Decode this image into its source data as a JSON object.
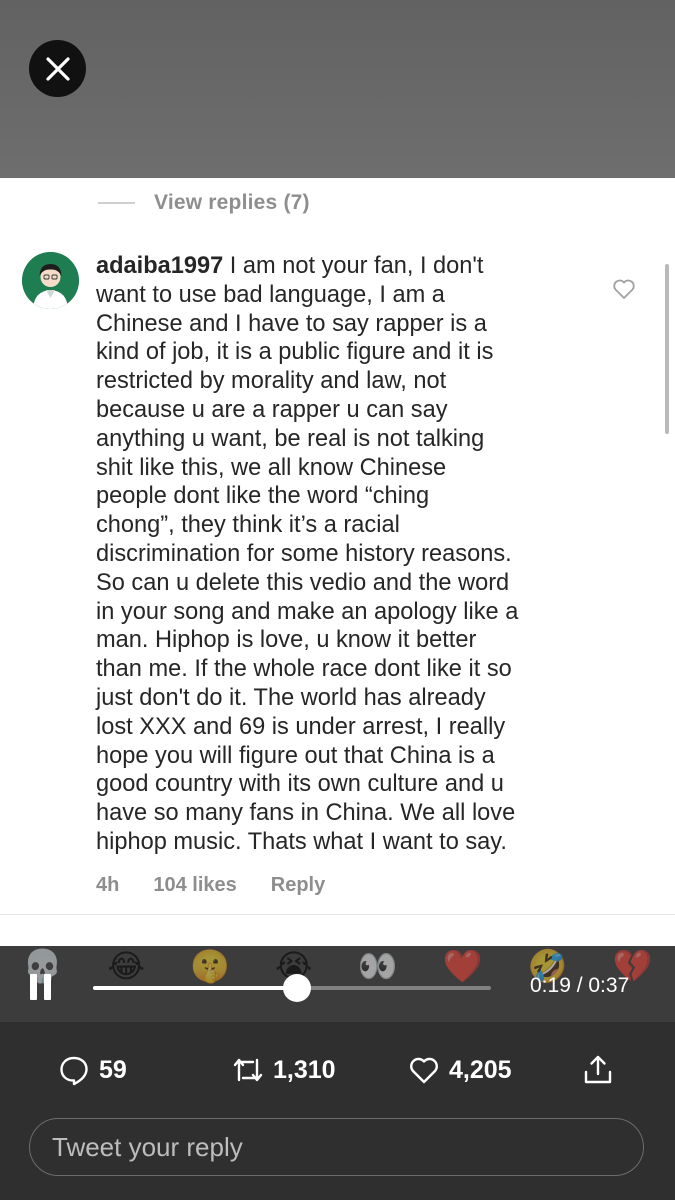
{
  "overlay": {
    "close_icon": "close-icon"
  },
  "comment": {
    "view_replies": "View replies (7)",
    "username": "adaiba1997",
    "lines": [
      " I am not your fan,  I don't",
      "want to use bad language,  I am a",
      "Chinese and I have to say rapper is a",
      "kind of job,  it is a public figure and it is",
      "restricted by morality and law,  not",
      "because u are a rapper u can say",
      "anything u want,  be real is not talking",
      "shit like this,  we all know Chinese",
      "people dont like the word “ching",
      "chong”,  they think it’s a racial",
      "discrimination for some history reasons.",
      "So can u delete this vedio and the word",
      "in your song and make an apology like a",
      "man. Hiphop is love,  u know it better",
      "than me. If the whole race dont like it so",
      "just don't do it. The world has already",
      "lost XXX and 69 is under arrest,  I really",
      "hope you will figure out that China is a",
      "good country with its own culture and u",
      "have so many fans in China. We all love",
      "hiphop music. Thats what I want to say."
    ],
    "time": "4h",
    "likes": "104 likes",
    "reply": "Reply"
  },
  "video": {
    "emojis": [
      "💀",
      "😂",
      "🤫",
      "😭",
      "👀",
      "❤️",
      "🤣",
      "💔"
    ],
    "time_display": "0:19 / 0:37",
    "progress": 0.5135,
    "state": "playing"
  },
  "actions": {
    "replies": "59",
    "retweets": "1,310",
    "likes": "4,205",
    "reply_placeholder": "Tweet your reply"
  }
}
